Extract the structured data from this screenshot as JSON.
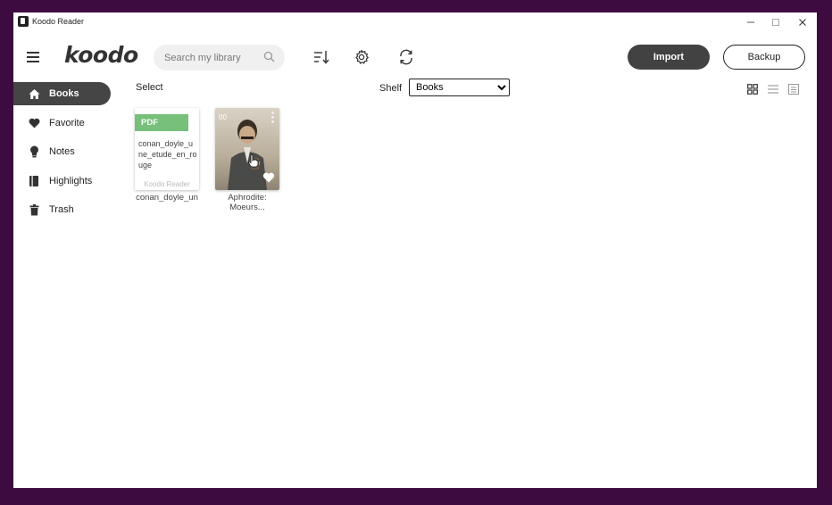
{
  "window": {
    "title": "Koodo Reader"
  },
  "header": {
    "logo": "koodo",
    "search_placeholder": "Search my library",
    "import_label": "Import",
    "backup_label": "Backup"
  },
  "sidebar": {
    "items": [
      {
        "label": "Books",
        "icon": "home-icon",
        "active": true
      },
      {
        "label": "Favorite",
        "icon": "heart-icon",
        "active": false
      },
      {
        "label": "Notes",
        "icon": "lightbulb-icon",
        "active": false
      },
      {
        "label": "Highlights",
        "icon": "book-icon",
        "active": false
      },
      {
        "label": "Trash",
        "icon": "trash-icon",
        "active": false
      }
    ]
  },
  "toolbar": {
    "select_label": "Select",
    "shelf_label": "Shelf",
    "shelf_value": "Books"
  },
  "books": [
    {
      "badge": "PDF",
      "cover_title": "conan_doyle_une_etude_en_rouge",
      "cover_footer": "Koodo Reader",
      "name": "conan_doyle_un"
    },
    {
      "progress": "00",
      "name_line1": "Aphrodite:",
      "name_line2": "Moeurs..."
    }
  ],
  "colors": {
    "background": "#3d0b3f",
    "active_nav": "#454545",
    "import_button": "#424242",
    "pdf_badge": "#76c07a"
  }
}
